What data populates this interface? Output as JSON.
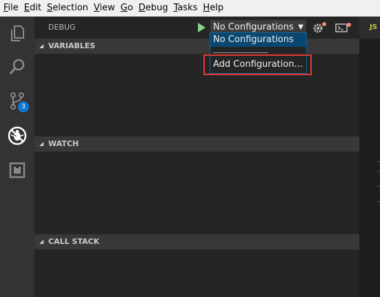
{
  "menubar": {
    "items": [
      {
        "mnemonic": "F",
        "rest": "ile"
      },
      {
        "mnemonic": "E",
        "rest": "dit"
      },
      {
        "mnemonic": "S",
        "rest": "election"
      },
      {
        "mnemonic": "V",
        "rest": "iew"
      },
      {
        "mnemonic": "G",
        "rest": "o"
      },
      {
        "mnemonic": "D",
        "rest": "ebug"
      },
      {
        "mnemonic": "T",
        "rest": "asks"
      },
      {
        "mnemonic": "H",
        "rest": "elp"
      }
    ]
  },
  "activity_bar": {
    "icons": [
      "explorer-icon",
      "search-icon",
      "source-control-icon",
      "debug-icon",
      "extensions-icon"
    ],
    "source_control_badge": "3"
  },
  "debug": {
    "title": "DEBUG",
    "configuration_selected": "No Configurations",
    "dropdown_options": [
      "No Configurations",
      "Add Configuration..."
    ]
  },
  "sections": {
    "variables": "VARIABLES",
    "watch": "WATCH",
    "call_stack": "CALL STACK"
  },
  "editor": {
    "tab_label": "JS"
  },
  "colors": {
    "start_green": "#89d185",
    "selection_blue": "#094771",
    "highlight_red": "#e53935",
    "badge_blue": "#0e7ad3"
  }
}
